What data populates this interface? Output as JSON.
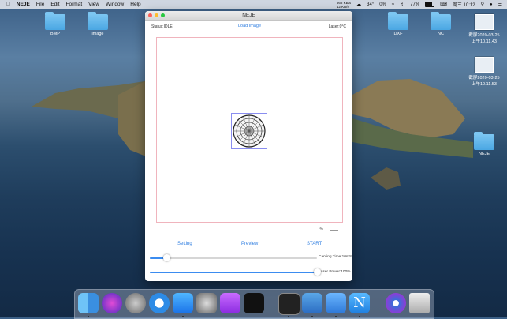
{
  "menubar": {
    "app": "NEJE",
    "items": [
      "File",
      "Edit",
      "Format",
      "View",
      "Window",
      "Help"
    ],
    "net_up": "668 KB/s",
    "net_down": "12 KB/s",
    "temp": "34°",
    "cpu": "0%",
    "battery": "77%",
    "clock": "周三 10:12"
  },
  "desktop": {
    "icons": [
      {
        "label": "BMP"
      },
      {
        "label": "image"
      },
      {
        "label": "DXF"
      },
      {
        "label": "NC"
      },
      {
        "label": "NEJE"
      }
    ],
    "screenshots": [
      {
        "label1": "截屏2020-03-25",
        "label2": "上午10.11.43"
      },
      {
        "label1": "截屏2020-03-25",
        "label2": "上午10.11.53"
      }
    ]
  },
  "window": {
    "title": "NEJE",
    "status": "Status:IDLE",
    "load_image": "Load Image",
    "laser": "Laser:0°C",
    "zoom_label": "-%",
    "buttons": {
      "setting": "Setting",
      "preview": "Preview",
      "start": "START"
    },
    "carving_time_label": "Carving Time:10mS",
    "laser_power_label": "Laser Power:100%",
    "carving_time_value": 0.1,
    "laser_power_value": 1.0
  },
  "dock": {
    "items": [
      "Finder",
      "Siri",
      "Launchpad",
      "Safari",
      "App Store",
      "System Preferences",
      "Podcasts",
      "Apple TV",
      "Terminal",
      "Xcode",
      "Preview",
      "NEJE",
      "Browser",
      "Trash"
    ]
  },
  "colors": {
    "accent": "#2e7de0",
    "canvas_border": "#f0b4bd",
    "selection": "#8a8ef0"
  }
}
